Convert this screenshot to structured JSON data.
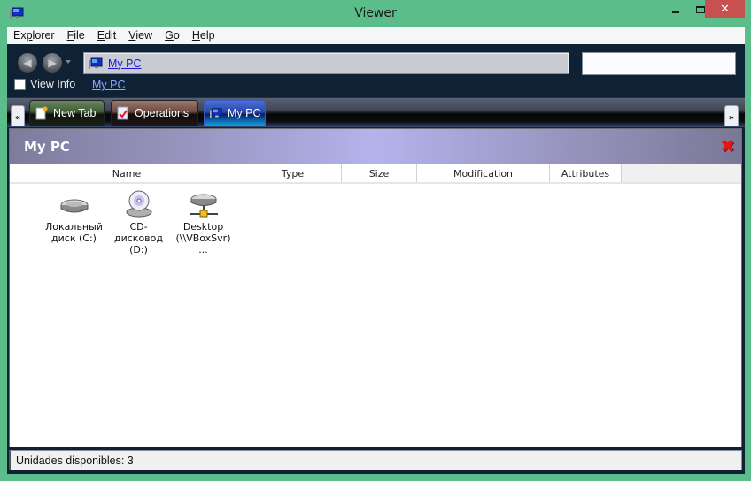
{
  "window": {
    "title": "Viewer",
    "close_glyph": "✕"
  },
  "menu": [
    {
      "label": "Explorer",
      "accel": "p"
    },
    {
      "label": "File",
      "accel": "F"
    },
    {
      "label": "Edit",
      "accel": "E"
    },
    {
      "label": "View",
      "accel": "V"
    },
    {
      "label": "Go",
      "accel": "G"
    },
    {
      "label": "Help",
      "accel": "H"
    }
  ],
  "nav": {
    "back_icon": "arrow-left-icon",
    "forward_icon": "arrow-right-icon",
    "address_text": "My PC",
    "search_value": "",
    "view_info_label": "View Info",
    "view_info_checked": false,
    "breadcrumb": "My PC"
  },
  "tabs": {
    "scroll_left": "«",
    "scroll_right": "»",
    "items": [
      {
        "label": "New Tab",
        "icon": "new-document-icon",
        "color": "#3c5a34"
      },
      {
        "label": "Operations",
        "icon": "checklist-icon",
        "color": "#6a4a40"
      },
      {
        "label": "My PC",
        "icon": "computer-icon",
        "color": "#2a48a8",
        "active": true
      }
    ]
  },
  "panel": {
    "title": "My PC",
    "close_icon": "red-x-icon",
    "close_glyph": "✖",
    "columns": [
      "Name",
      "Type",
      "Size",
      "Modification",
      "Attributes"
    ],
    "items": [
      {
        "line1": "Локальный",
        "line2": "диск (C:)",
        "icon": "hard-drive-icon"
      },
      {
        "line1": "CD-дисковод",
        "line2": "(D:)",
        "icon": "cd-drive-icon"
      },
      {
        "line1": "Desktop",
        "line2": "(\\\\VBoxSvr) ...",
        "icon": "network-drive-icon"
      }
    ]
  },
  "status": {
    "text": "Unidades disponibles: 3"
  }
}
